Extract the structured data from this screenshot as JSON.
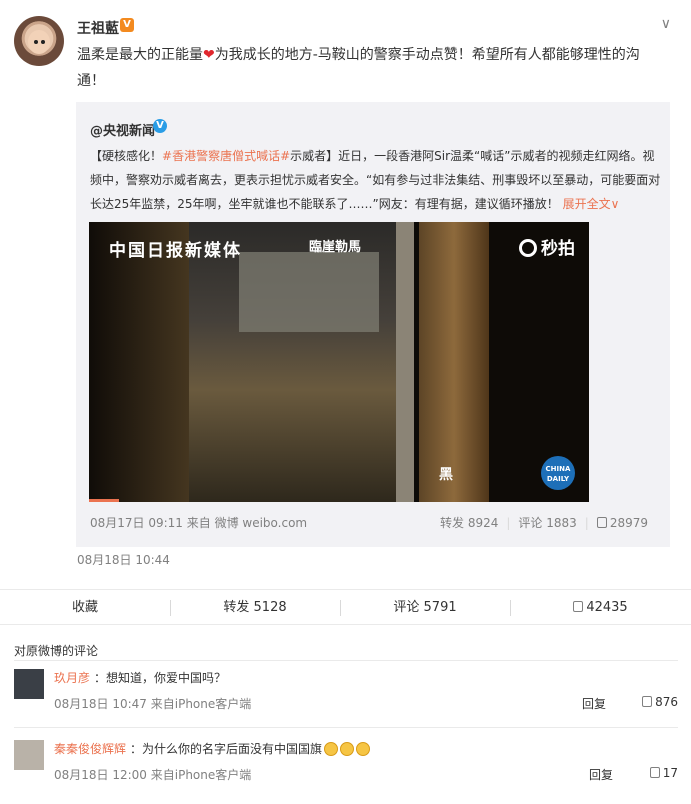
{
  "post": {
    "author": "王祖藍",
    "verified_badge": "V",
    "text_before_heart": "温柔是最大的正能量",
    "heart": "❤",
    "text_after_heart": "为我成长的地方-马鞍山的警察手动点赞！希望所有人都能够理性的沟通！",
    "time": "08月18日 10:44",
    "menu_icon": "chevron-down-icon"
  },
  "repost": {
    "author": "@央视新闻",
    "verified_badge": "V",
    "text_prefix": "【硬核感化！",
    "hashtag": "#香港警察唐僧式喊话#",
    "text_body": "示威者】近日，一段香港阿Sir温柔“喊话”示威者的视频走红网络。视频中，警察劝示威者离去，更表示担忧示威者安全。“如有参与过非法集结、刑事毁坏以至暴动，可能要面对长达25年监禁，25年啊，坐牢就谁也不能联系了……”网友：有理有据，建议循环播放！",
    "expand_label": "展开全文",
    "video": {
      "logo": "中国日报新媒体",
      "sign": "臨崖勒馬",
      "miaopai": "秒拍",
      "watermark": "黑",
      "china_daily": "CHINA DAILY",
      "progress": 0.06
    },
    "meta": "08月17日 09:11 来自 微博 weibo.com",
    "repost_count": "转发 8924",
    "comment_count": "评论 1883",
    "like_count": "28979"
  },
  "actions": {
    "favorite": "收藏",
    "repost": "转发 5128",
    "comment": "评论 5791",
    "like": "42435"
  },
  "comments_header": "对原微博的评论",
  "comments": [
    {
      "name": "玖月彦",
      "text": "：想知道，你爱中国吗？",
      "time": "08月18日 10:47 来自iPhone客户端",
      "reply": "回复",
      "likes": "876"
    },
    {
      "name": "秦秦俊俊辉辉",
      "text": "：为什么你的名字后面没有中国国旗",
      "time": "08月18日 12:00 来自iPhone客户端",
      "reply": "回复",
      "likes": "17"
    }
  ]
}
